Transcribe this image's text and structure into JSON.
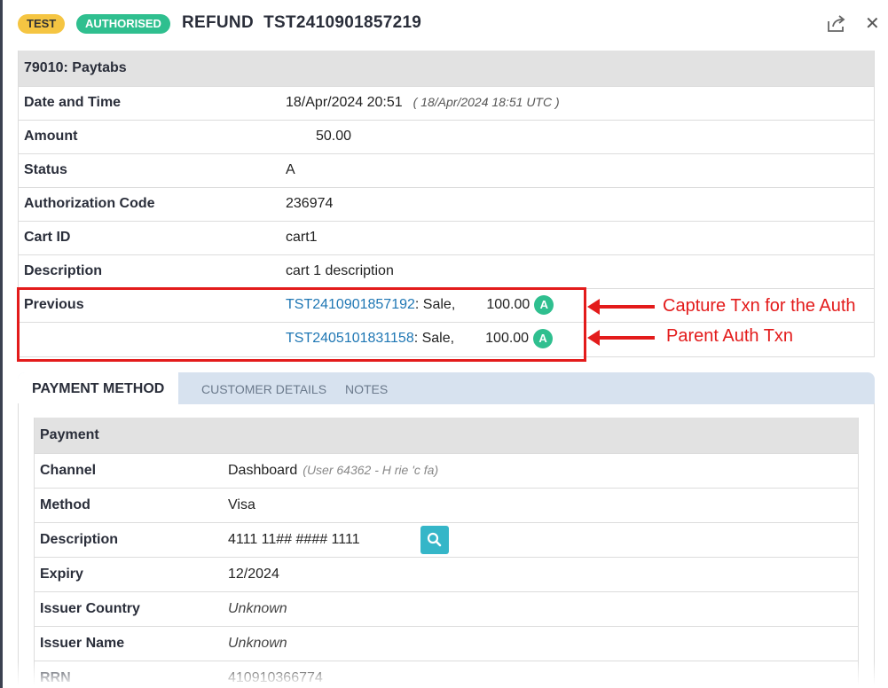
{
  "header": {
    "badge_test": "TEST",
    "badge_status": "AUTHORISED",
    "title": "REFUND  TST2410901857219"
  },
  "info": {
    "section_title": "79010: Paytabs",
    "date_label": "Date and Time",
    "date_value": "18/Apr/2024 20:51",
    "date_utc": "( 18/Apr/2024 18:51 UTC )",
    "amount_label": "Amount",
    "amount_value": "50.00",
    "status_label": "Status",
    "status_value": "A",
    "auth_code_label": "Authorization Code",
    "auth_code_value": "236974",
    "cart_id_label": "Cart ID",
    "cart_id_value": "cart1",
    "description_label": "Description",
    "description_value": "cart 1 description",
    "previous_label": "Previous",
    "previous": [
      {
        "txn": "TST2410901857192",
        "type": ": Sale,",
        "amount": "100.00",
        "status": "A"
      },
      {
        "txn": "TST2405101831158",
        "type": ": Sale,",
        "amount": "100.00",
        "status": "A"
      }
    ]
  },
  "annotations": {
    "capture": "Capture Txn for the Auth",
    "parent": "Parent Auth Txn",
    "color": "#e31b1b"
  },
  "tabs": [
    "PAYMENT METHOD",
    "CUSTOMER DETAILS",
    "NOTES"
  ],
  "payment": {
    "section_title": "Payment",
    "channel_label": "Channel",
    "channel_value": "Dashboard",
    "channel_user": "(User 64362 - H     rie     'c     fa)",
    "method_label": "Method",
    "method_value": "Visa",
    "description_label": "Description",
    "description_value": "4111 11## #### 1111",
    "expiry_label": "Expiry",
    "expiry_value": "12/2024",
    "issuer_country_label": "Issuer Country",
    "issuer_country_value": "Unknown",
    "issuer_name_label": "Issuer Name",
    "issuer_name_value": "Unknown",
    "rrn_label": "RRN",
    "rrn_value": "410910366774"
  },
  "colors": {
    "accent_green": "#2fbf8f",
    "badge_yellow": "#f5c542",
    "link": "#1f77b4",
    "search_btn": "#35b6c8"
  },
  "icons": [
    "share-icon",
    "close-icon",
    "search-icon"
  ]
}
